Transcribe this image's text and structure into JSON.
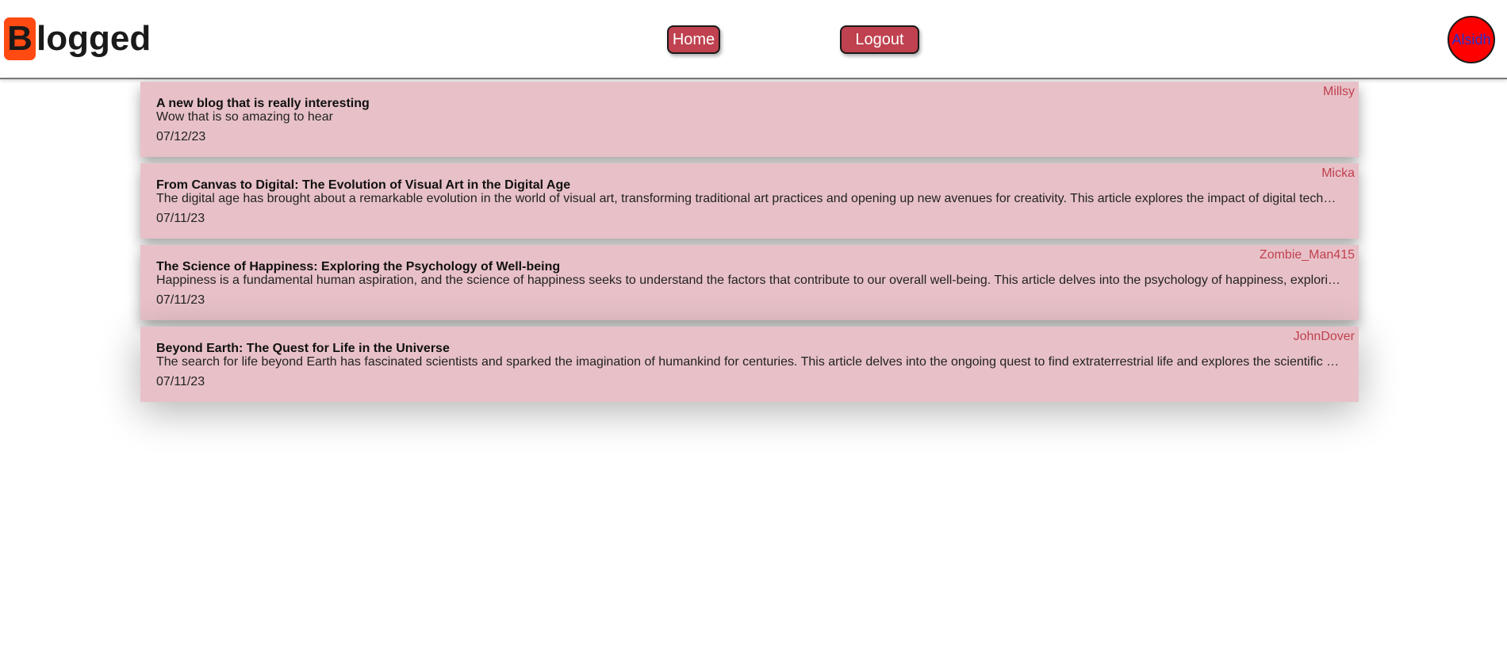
{
  "header": {
    "logo_initial": "B",
    "logo_rest": "logged",
    "nav": {
      "home_label": "Home",
      "logout_label": "Logout"
    },
    "avatar_text": "Alsidh"
  },
  "posts": [
    {
      "author": "Millsy",
      "title": "A new blog that is really interesting",
      "body": "Wow that is so amazing to hear",
      "date": "07/12/23"
    },
    {
      "author": "Micka",
      "title": "From Canvas to Digital: The Evolution of Visual Art in the Digital Age",
      "body": "The digital age has brought about a remarkable evolution in the world of visual art, transforming traditional art practices and opening up new avenues for creativity. This article explores the impact of digital tech…",
      "date": "07/11/23"
    },
    {
      "author": "Zombie_Man415",
      "title": "The Science of Happiness: Exploring the Psychology of Well-being",
      "body": "Happiness is a fundamental human aspiration, and the science of happiness seeks to understand the factors that contribute to our overall well-being. This article delves into the psychology of happiness, explori…",
      "date": "07/11/23"
    },
    {
      "author": "JohnDover",
      "title": "Beyond Earth: The Quest for Life in the Universe",
      "body": "The search for life beyond Earth has fascinated scientists and sparked the imagination of humankind for centuries. This article delves into the ongoing quest to find extraterrestrial life and explores the scientific …",
      "date": "07/11/23"
    }
  ],
  "colors": {
    "logo_badge": "#ff4a12",
    "button_bg": "#c0414f",
    "card_bg": "#e8c1c8",
    "author_text": "#c0414f",
    "avatar_bg": "#ff0000",
    "avatar_text": "#2233cc"
  }
}
